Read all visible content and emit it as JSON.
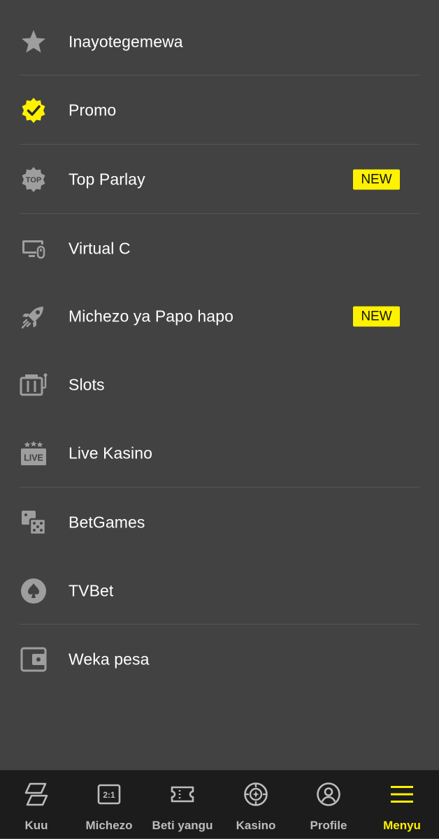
{
  "menu": {
    "items": [
      {
        "label": "Inayotegemewa",
        "icon": "star-icon"
      },
      {
        "label": "Promo",
        "icon": "verified-badge-icon"
      },
      {
        "label": "Top Parlay",
        "icon": "top-badge-icon",
        "badge": "NEW"
      },
      {
        "label": "Virtual C",
        "icon": "monitor-icon"
      },
      {
        "label": "Michezo ya Papo hapo",
        "icon": "rocket-icon",
        "badge": "NEW"
      },
      {
        "label": "Slots",
        "icon": "slot-machine-icon"
      },
      {
        "label": "Live Kasino",
        "icon": "live-icon"
      },
      {
        "label": "BetGames",
        "icon": "dice-icon"
      },
      {
        "label": "TVBet",
        "icon": "spade-icon"
      },
      {
        "label": "Weka pesa",
        "icon": "wallet-icon"
      }
    ],
    "live_icon_text": "LIVE",
    "top_icon_text": "TOP"
  },
  "bottom_nav": {
    "tabs": [
      {
        "label": "Kuu",
        "icon": "home-icon"
      },
      {
        "label": "Michezo",
        "icon": "odds-icon",
        "icon_text": "2:1"
      },
      {
        "label": "Beti yangu",
        "icon": "ticket-icon"
      },
      {
        "label": "Kasino",
        "icon": "casino-chip-icon"
      },
      {
        "label": "Profile",
        "icon": "profile-icon"
      },
      {
        "label": "Menyu",
        "icon": "hamburger-icon",
        "active": true
      }
    ]
  },
  "colors": {
    "background": "#424242",
    "nav_background": "#1c1c1c",
    "accent": "#fff200",
    "icon_gray": "#9e9e9e"
  }
}
